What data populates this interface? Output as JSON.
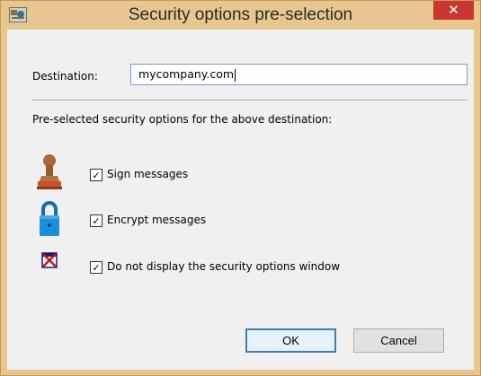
{
  "window": {
    "title": "Security options pre-selection",
    "close_label": "✕",
    "accent_color": "#e7c68f",
    "close_color": "#c7372f"
  },
  "destination": {
    "label": "Destination:",
    "value": "mycompany.com"
  },
  "options_heading": "Pre-selected security options for the above destination:",
  "options": [
    {
      "label": "Sign messages",
      "checked": true,
      "icon": "stamp-icon"
    },
    {
      "label": "Encrypt messages",
      "checked": true,
      "icon": "padlock-icon"
    },
    {
      "label": "Do not display the security options window",
      "checked": true,
      "icon": "no-window-icon"
    }
  ],
  "buttons": {
    "ok": "OK",
    "cancel": "Cancel"
  }
}
